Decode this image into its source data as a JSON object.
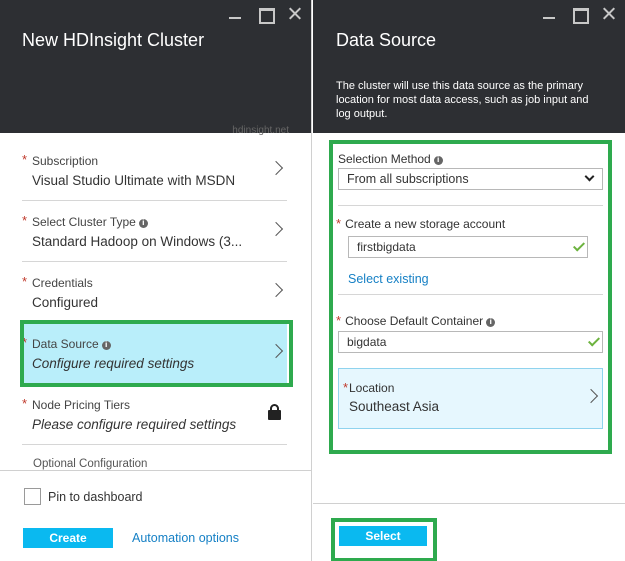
{
  "left_blade": {
    "title": "New HDInsight Cluster",
    "clipped_text": "hdinsight.net",
    "items": [
      {
        "label": "Subscription",
        "value": "Visual Studio Ultimate with MSDN",
        "required": "*"
      },
      {
        "label": "Select Cluster Type",
        "value": "Standard Hadoop on Windows (3...",
        "required": "*"
      },
      {
        "label": "Credentials",
        "value": "Configured",
        "required": "*"
      },
      {
        "label": "Data Source",
        "value": "Configure required settings",
        "required": "*"
      },
      {
        "label": "Node Pricing Tiers",
        "value": "Please configure required settings",
        "required": "*"
      }
    ],
    "optional_label": "Optional Configuration",
    "pin_label": "Pin to dashboard",
    "create_label": "Create",
    "automation_label": "Automation options"
  },
  "right_blade": {
    "title": "Data Source",
    "description": "The cluster will use this data source as the primary location for most data access, such as job input and log output.",
    "selection_method": {
      "label": "Selection Method",
      "value": "From all subscriptions"
    },
    "storage_account": {
      "label": "Create a new storage account",
      "value": "firstbigdata",
      "required": "*"
    },
    "select_existing_label": "Select existing",
    "container": {
      "label": "Choose Default Container",
      "value": "bigdata",
      "required": "*"
    },
    "location": {
      "label": "Location",
      "value": "Southeast Asia",
      "required": "*"
    },
    "select_label": "Select"
  },
  "icons": {
    "info": "i",
    "minimize": "minimize-icon",
    "maximize": "maximize-icon",
    "close": "close-icon",
    "lock": "lock-icon",
    "chevron": "chevron-right-icon",
    "check": "check-icon"
  },
  "colors": {
    "header_bg": "#2d2f33",
    "accent": "#0ab9f0",
    "highlight": "#b9eefa",
    "annotation_green": "#2eaa4e",
    "required_star": "#c0392b",
    "link": "#1680c5",
    "valid_check": "#6cb33e"
  }
}
